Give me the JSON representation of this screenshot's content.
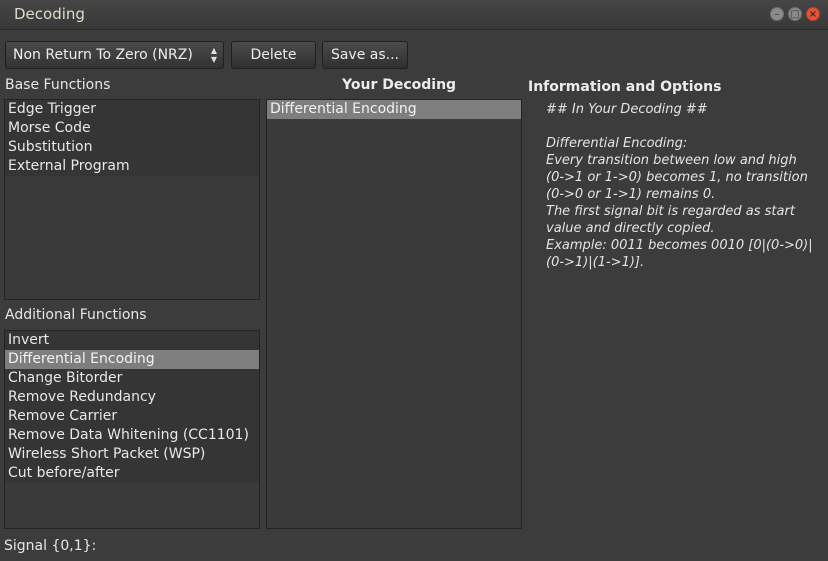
{
  "window": {
    "title": "Decoding",
    "controls": [
      "minimize-icon",
      "maximize-icon",
      "close-icon"
    ]
  },
  "toolbar": {
    "decoding_select": "Non Return To Zero (NRZ)",
    "delete_label": "Delete",
    "save_as_label": "Save as..."
  },
  "base_functions": {
    "label": "Base Functions",
    "items": [
      "Edge Trigger",
      "Morse Code",
      "Substitution",
      "External Program"
    ]
  },
  "additional_functions": {
    "label": "Additional Functions",
    "items": [
      "Invert",
      "Differential Encoding",
      "Change Bitorder",
      "Remove Redundancy",
      "Remove Carrier",
      "Remove Data Whitening (CC1101)",
      "Wireless Short Packet (WSP)",
      "Cut before/after"
    ],
    "selected": "Differential Encoding"
  },
  "your_decoding": {
    "label": "Your Decoding",
    "items": [
      "Differential Encoding"
    ]
  },
  "info": {
    "label": "Information and Options",
    "lines": [
      "## In Your Decoding ##",
      "",
      "Differential Encoding:",
      "Every transition between low and high",
      "(0->1 or 1->0) becomes 1, no transition",
      "(0->0 or 1->1) remains 0.",
      "The first signal bit is regarded as start",
      "value and directly copied.",
      "Example: 0011 becomes 0010 [0|(0->0)|",
      "(0->1)|(1->1)]."
    ]
  },
  "signal": {
    "label": "Signal {0,1}:"
  }
}
